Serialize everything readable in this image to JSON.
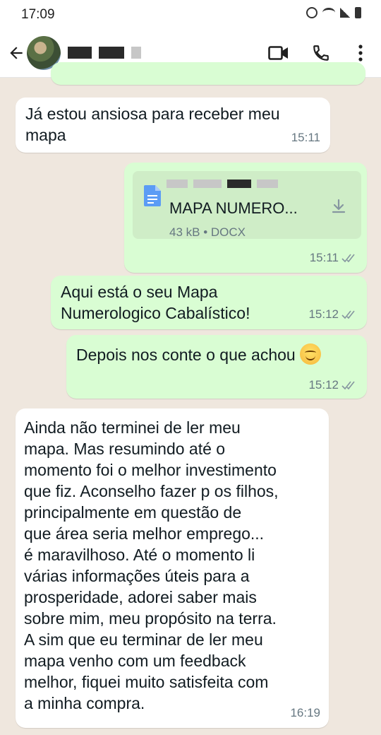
{
  "status_bar": {
    "time": "17:09"
  },
  "header": {
    "back_icon": "arrow-left-icon",
    "icons": [
      "video-call-icon",
      "phone-icon",
      "more-vert-icon"
    ]
  },
  "messages": [
    {
      "direction": "incoming",
      "text_lines": [
        "Já estou ansiosa para receber meu",
        "mapa"
      ],
      "time": "15:11"
    },
    {
      "direction": "outgoing",
      "type": "document",
      "doc_name": "MAPA NUMERO...",
      "doc_info": "43 kB • DOCX",
      "time": "15:11",
      "status": "read"
    },
    {
      "direction": "outgoing",
      "text_lines": [
        "Aqui está o seu Mapa",
        "Numerologico Cabalístico!"
      ],
      "time": "15:12",
      "status": "read"
    },
    {
      "direction": "outgoing",
      "text_lines": [
        "Depois nos conte o que achou"
      ],
      "emoji": "smiling-face-icon",
      "time": "15:12",
      "status": "read"
    },
    {
      "direction": "incoming",
      "text_lines": [
        "Ainda não terminei de ler meu",
        "mapa. Mas resumindo até o",
        "momento foi o melhor investimento",
        "que fiz. Aconselho fazer p os filhos,",
        "principalmente em questão de",
        "que área seria melhor emprego...",
        "é maravilhoso. Até o momento li",
        "várias informações úteis para a",
        "prosperidade, adorei saber mais",
        "sobre mim, meu propósito na terra.",
        "A sim que eu terminar de ler meu",
        "mapa venho com um feedback",
        "melhor, fiquei muito satisfeita com",
        "a minha compra."
      ],
      "time": "16:19"
    }
  ],
  "colors": {
    "chat_bg": "#efe7de",
    "incoming_bubble": "#ffffff",
    "outgoing_bubble": "#d9fdd3",
    "doc_card": "#cfedc7",
    "meta_text": "#667781",
    "doc_icon": "#5b9cf5"
  }
}
